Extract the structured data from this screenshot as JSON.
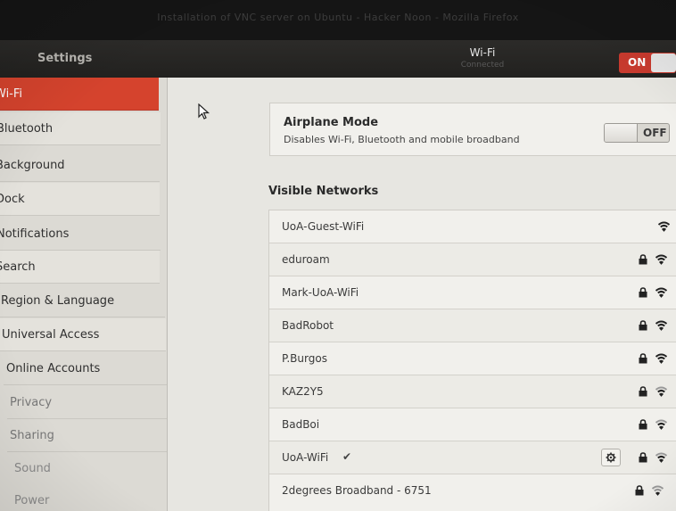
{
  "window": {
    "title": "Installation of VNC server on Ubuntu - Hacker Noon - Mozilla Firefox"
  },
  "header": {
    "settings_label": "Settings",
    "wifi_title": "Wi-Fi",
    "wifi_subtitle": "Connected",
    "toggle_label": "ON"
  },
  "sidebar": {
    "items": [
      {
        "label": "Wi-Fi"
      },
      {
        "label": "Bluetooth"
      },
      {
        "label": "Background"
      },
      {
        "label": "Dock"
      },
      {
        "label": "Notifications"
      },
      {
        "label": "Search"
      },
      {
        "label": "Region & Language"
      },
      {
        "label": "Universal Access"
      },
      {
        "label": "Online Accounts"
      },
      {
        "label": "Privacy"
      },
      {
        "label": "Sharing"
      },
      {
        "label": "Sound"
      },
      {
        "label": "Power"
      }
    ]
  },
  "airplane": {
    "title": "Airplane Mode",
    "description": "Disables Wi-Fi, Bluetooth and mobile broadband",
    "toggle_label": "OFF"
  },
  "networks": {
    "heading": "Visible Networks",
    "items": [
      {
        "name": "UoA-Guest-WiFi",
        "secured": false
      },
      {
        "name": "eduroam",
        "secured": true
      },
      {
        "name": "Mark-UoA-WiFi",
        "secured": true
      },
      {
        "name": "BadRobot",
        "secured": true
      },
      {
        "name": "P.Burgos",
        "secured": true
      },
      {
        "name": "KAZ2Y5",
        "secured": true
      },
      {
        "name": "BadBoi",
        "secured": true
      },
      {
        "name": "UoA-WiFi",
        "secured": true,
        "connected_mark": "✔"
      },
      {
        "name": "2degrees Broadband - 6751",
        "secured": true
      }
    ]
  },
  "colors": {
    "accent": "#d5432d",
    "header_bg": "#2c2b29",
    "sidebar_bg": "#dcdad4"
  },
  "icons": [
    "cursor-icon",
    "lock-icon",
    "wifi-icon",
    "gear-icon"
  ]
}
